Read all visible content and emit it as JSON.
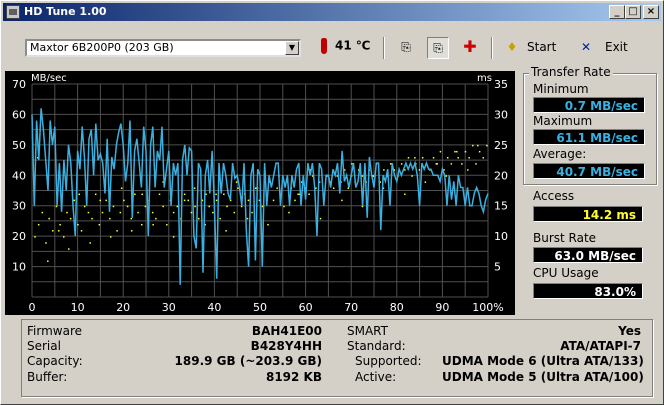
{
  "window": {
    "title": "HD Tune 1.00"
  },
  "toolbar": {
    "drive": "Maxtor 6B200P0 (203 GB)",
    "temperature": "41 ℃",
    "start_label": "Start",
    "exit_label": "Exit"
  },
  "icons": {
    "app": "hdtune-app-icon",
    "temp": "thermometer-icon",
    "copy": "copy-icon",
    "copy_all": "copy-all-icon",
    "health": "health-cross-icon",
    "start": "start-bulb-icon",
    "exit": "exit-x-icon"
  },
  "colors": {
    "transfer_line": "#3ab0e0",
    "access_points": "#ffff30",
    "chart_bg": "#000000",
    "grid": "#505050",
    "titlebar_start": "#0a246a",
    "titlebar_end": "#a6caf0"
  },
  "transfer_rate": {
    "title": "Transfer Rate",
    "minimum_label": "Minimum",
    "minimum": "0.7 MB/sec",
    "maximum_label": "Maximum",
    "maximum": "61.1 MB/sec",
    "average_label": "Average:",
    "average": "40.7 MB/sec"
  },
  "access": {
    "label": "Access",
    "value": "14.2 ms"
  },
  "burst": {
    "label": "Burst Rate",
    "value": "63.0 MB/sec"
  },
  "cpu": {
    "label": "CPU Usage",
    "value": "83.0%"
  },
  "info": {
    "firmware_label": "Firmware",
    "firmware": "BAH41E00",
    "serial_label": "Serial",
    "serial": "B428Y4HH",
    "capacity_label": "Capacity:",
    "capacity": "189.9 GB (~203.9 GB)",
    "buffer_label": "Buffer:",
    "buffer": "8192 KB",
    "smart_label": "SMART",
    "smart": "Yes",
    "standard_label": "Standard:",
    "standard": "ATA/ATAPI-7",
    "supported_label": "Supported:",
    "supported": "UDMA Mode 6 (Ultra ATA/133)",
    "active_label": "Active:",
    "active": "UDMA Mode 5 (Ultra ATA/100)"
  },
  "chart_data": {
    "type": "line",
    "left_unit": "MB/sec",
    "right_unit": "ms",
    "ylim_left": [
      0,
      70
    ],
    "ylim_right": [
      0,
      35
    ],
    "xlim": [
      0,
      100
    ],
    "left_ticks": [
      "10",
      "20",
      "30",
      "40",
      "50",
      "60",
      "70"
    ],
    "right_ticks": [
      "5",
      "10",
      "15",
      "20",
      "25",
      "30",
      "35"
    ],
    "x_ticks": [
      "0",
      "10",
      "20",
      "30",
      "40",
      "50",
      "60",
      "70",
      "80",
      "90",
      "100%"
    ],
    "grid": true,
    "series": [
      {
        "kind": "transfer",
        "x": [
          0,
          0.5,
          1,
          1.5,
          2,
          2.5,
          3,
          3.5,
          4,
          4.5,
          5,
          5.5,
          6,
          6.5,
          7,
          7.5,
          8,
          8.5,
          9,
          9.5,
          10,
          10.5,
          11,
          11.5,
          12,
          12.5,
          13,
          13.5,
          14,
          14.5,
          15,
          15.5,
          16,
          16.5,
          17,
          17.5,
          18,
          18.5,
          19,
          19.5,
          20,
          20.5,
          21,
          21.5,
          22,
          22.5,
          23,
          23.5,
          24,
          24.5,
          25,
          25.5,
          26,
          26.5,
          27,
          27.5,
          28,
          28.5,
          29,
          29.5,
          30,
          30.5,
          31,
          31.5,
          32,
          32.5,
          33,
          33.5,
          34,
          34.5,
          35,
          35.5,
          36,
          36.5,
          37,
          37.5,
          38,
          38.5,
          39,
          39.5,
          40,
          40.5,
          41,
          41.5,
          42,
          42.5,
          43,
          43.5,
          44,
          44.5,
          45,
          45.5,
          46,
          46.5,
          47,
          47.5,
          48,
          48.5,
          49,
          49.5,
          50,
          50.5,
          51,
          51.5,
          52,
          52.5,
          53,
          53.5,
          54,
          54.5,
          55,
          55.5,
          56,
          56.5,
          57,
          57.5,
          58,
          58.5,
          59,
          59.5,
          60,
          60.5,
          61,
          61.5,
          62,
          62.5,
          63,
          63.5,
          64,
          64.5,
          65,
          65.5,
          66,
          66.5,
          67,
          67.5,
          68,
          68.5,
          69,
          69.5,
          70,
          70.5,
          71,
          71.5,
          72,
          72.5,
          73,
          73.5,
          74,
          74.5,
          75,
          75.5,
          76,
          76.5,
          77,
          77.5,
          78,
          78.5,
          79,
          79.5,
          80,
          80.5,
          81,
          81.5,
          82,
          82.5,
          83,
          83.5,
          84,
          84.5,
          85,
          85.5,
          86,
          86.5,
          87,
          87.5,
          88,
          88.5,
          89,
          89.5,
          90,
          90.5,
          91,
          91.5,
          92,
          92.5,
          93,
          93.5,
          94,
          94.5,
          95,
          95.5,
          96,
          96.5,
          97,
          97.5,
          98,
          98.5,
          99,
          99.5,
          100
        ],
        "y": [
          60,
          30,
          58,
          45,
          62,
          55,
          45,
          35,
          58,
          50,
          56,
          30,
          44,
          28,
          45,
          35,
          50,
          44,
          30,
          20,
          48,
          42,
          56,
          46,
          30,
          52,
          55,
          40,
          57,
          45,
          47,
          44,
          34,
          52,
          28,
          46,
          42,
          50,
          54,
          57,
          50,
          38,
          44,
          58,
          26,
          48,
          52,
          44,
          36,
          56,
          48,
          20,
          50,
          56,
          36,
          48,
          45,
          56,
          36,
          42,
          48,
          30,
          44,
          40,
          44,
          4,
          45,
          50,
          40,
          49,
          48,
          20,
          16,
          44,
          42,
          8,
          40,
          45,
          34,
          48,
          30,
          6,
          44,
          34,
          44,
          40,
          34,
          32,
          44,
          39,
          40,
          36,
          30,
          44,
          22,
          10,
          40,
          44,
          12,
          42,
          40,
          10,
          44,
          30,
          40,
          36,
          40,
          44,
          44,
          30,
          40,
          36,
          40,
          30,
          40,
          36,
          42,
          44,
          30,
          40,
          32,
          44,
          40,
          44,
          36,
          20,
          44,
          42,
          30,
          40,
          40,
          36,
          42,
          40,
          44,
          34,
          48,
          38,
          40,
          36,
          40,
          44,
          36,
          38,
          44,
          30,
          44,
          26,
          46,
          40,
          36,
          44,
          44,
          22,
          40,
          38,
          42,
          30,
          44,
          40,
          38,
          42,
          40,
          42,
          44,
          42,
          44,
          42,
          44,
          40,
          30,
          44,
          42,
          44,
          42,
          42,
          40,
          40,
          40,
          38,
          42,
          40,
          30,
          40,
          32,
          38,
          30,
          40,
          36,
          36,
          30,
          36,
          30,
          30,
          34,
          36,
          34,
          30,
          28,
          32,
          34
        ]
      },
      {
        "kind": "access",
        "x": [
          0.5,
          1.3,
          2.1,
          2.9,
          3.6,
          4.4,
          5.2,
          6,
          6.8,
          7.5,
          8.3,
          9.1,
          9.9,
          10.7,
          11.4,
          12.2,
          13,
          13.8,
          14.6,
          15.3,
          16.1,
          16.9,
          17.7,
          18.5,
          19.2,
          20,
          20.8,
          21.6,
          22.4,
          23.1,
          23.9,
          24.7,
          25.5,
          26.3,
          27,
          27.8,
          28.6,
          29.4,
          30.2,
          30.9,
          31.7,
          32.5,
          33.3,
          34.1,
          34.8,
          35.6,
          36.4,
          37.2,
          38,
          38.7,
          39.5,
          40.3,
          41.1,
          41.9,
          42.6,
          43.4,
          44.2,
          45,
          45.8,
          46.5,
          47.3,
          48.1,
          48.9,
          49.7,
          50.4,
          51.2,
          52,
          52.8,
          53.6,
          54.3,
          55.1,
          55.9,
          56.7,
          57.5,
          58.2,
          59,
          59.8,
          60.6,
          61.4,
          62.1,
          62.9,
          63.7,
          64.5,
          65.3,
          66,
          66.8,
          67.6,
          68.4,
          69.2,
          69.9,
          70.7,
          71.5,
          72.3,
          73.1,
          73.8,
          74.6,
          75.4,
          76.2,
          77,
          77.7,
          78.5,
          79.3,
          80.1,
          80.9,
          81.6,
          82.4,
          83.2,
          84,
          84.8,
          85.5,
          86.3,
          87.1,
          87.9,
          88.7,
          89.4,
          90.2,
          91,
          91.8,
          92.6,
          93.3,
          94.1,
          94.9,
          95.7,
          96.5,
          97.2,
          98,
          98.8,
          99.6,
          1.1,
          3.3,
          5.7,
          7.9,
          10.2,
          12.6,
          14.8,
          17.1,
          19.5,
          21.7,
          24,
          26.4,
          28.6,
          30.9,
          33.3,
          35.5,
          37.8,
          40.2,
          42.4,
          44.7,
          47.1,
          49.3,
          51.6,
          54,
          56.2,
          58.5,
          60.9,
          63.1,
          65.4,
          67.8,
          70,
          72.3,
          74.7,
          76.9,
          79.2,
          81.6,
          83.8,
          86.1,
          88.5,
          90.7,
          93,
          95.4,
          97.6
        ],
        "y": [
          10,
          12,
          14,
          9,
          13,
          11,
          15,
          12,
          10,
          14,
          13,
          16,
          12,
          11,
          15,
          14,
          13,
          17,
          12,
          14,
          16,
          13,
          15,
          11,
          14,
          16,
          15,
          13,
          17,
          14,
          12,
          15,
          16,
          14,
          13,
          17,
          15,
          12,
          16,
          14,
          15,
          13,
          17,
          16,
          14,
          15,
          13,
          16,
          17,
          15,
          14,
          16,
          13,
          17,
          15,
          16,
          14,
          18,
          15,
          17,
          16,
          14,
          18,
          16,
          15,
          17,
          19,
          16,
          18,
          17,
          15,
          19,
          18,
          16,
          17,
          19,
          18,
          17,
          20,
          18,
          19,
          17,
          20,
          19,
          18,
          20,
          19,
          21,
          18,
          20,
          19,
          21,
          20,
          19,
          21,
          20,
          22,
          19,
          21,
          20,
          22,
          21,
          20,
          22,
          21,
          23,
          20,
          22,
          21,
          23,
          22,
          21,
          23,
          22,
          24,
          21,
          23,
          22,
          24,
          23,
          22,
          24,
          23,
          25,
          22,
          24,
          23,
          25,
          23,
          6,
          11,
          8,
          17,
          9,
          16,
          10,
          18,
          11,
          17,
          12,
          19,
          10,
          16,
          18,
          12,
          17,
          11,
          19,
          13,
          18,
          12,
          20,
          14,
          17,
          21,
          13,
          19,
          16,
          22,
          15,
          20,
          18,
          21,
          17,
          23,
          19,
          22,
          20,
          24,
          21,
          25
        ]
      }
    ]
  }
}
